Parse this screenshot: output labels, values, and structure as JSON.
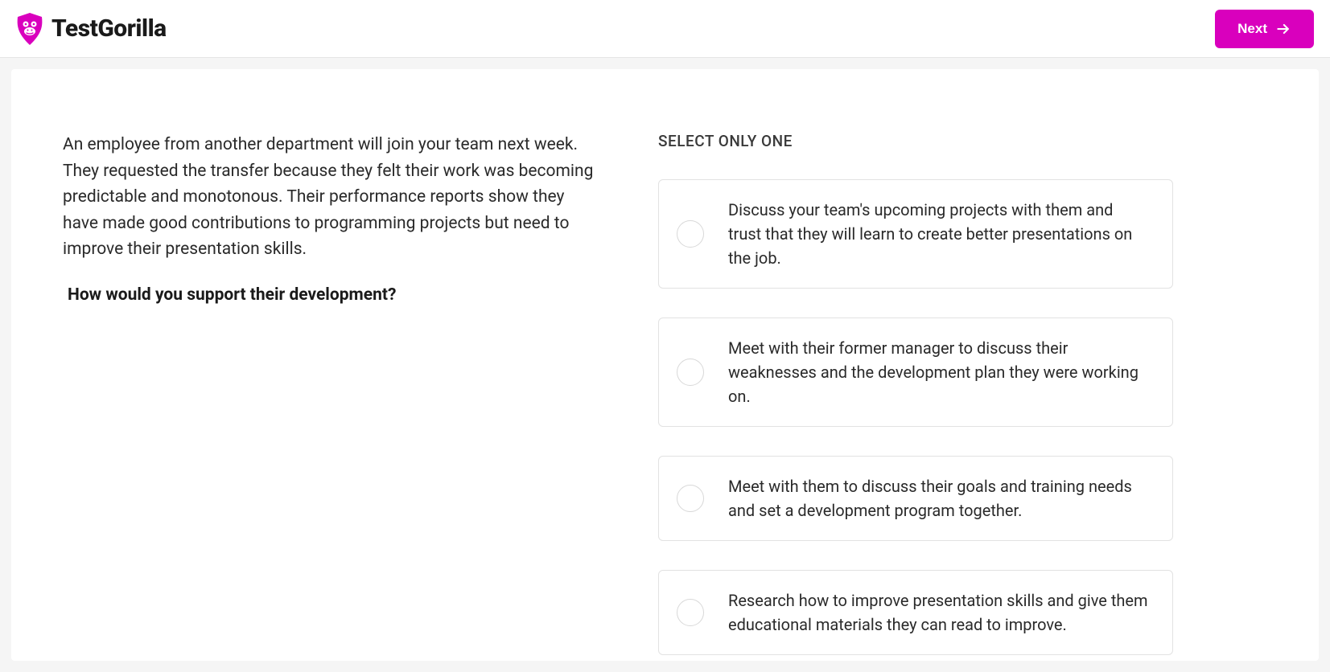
{
  "header": {
    "brand": "TestGorilla",
    "next_label": "Next"
  },
  "question": {
    "scenario": "An employee from another department will join your team next week. They requested the transfer because they felt their work was becoming predictable and monotonous. Their performance reports show they have made good contributions to programming projects but need to improve their presentation skills.",
    "prompt": "How would you support their development?",
    "instruction": "SELECT ONLY ONE",
    "options": [
      "Discuss your team's upcoming projects with them and trust that they will learn to create better presentations on the job.",
      "Meet with their former manager to discuss their weaknesses and the development plan they were working on.",
      "Meet with them to discuss their goals and training needs and set a development program together.",
      "Research how to improve presentation skills and give them educational materials they can read to improve."
    ]
  }
}
